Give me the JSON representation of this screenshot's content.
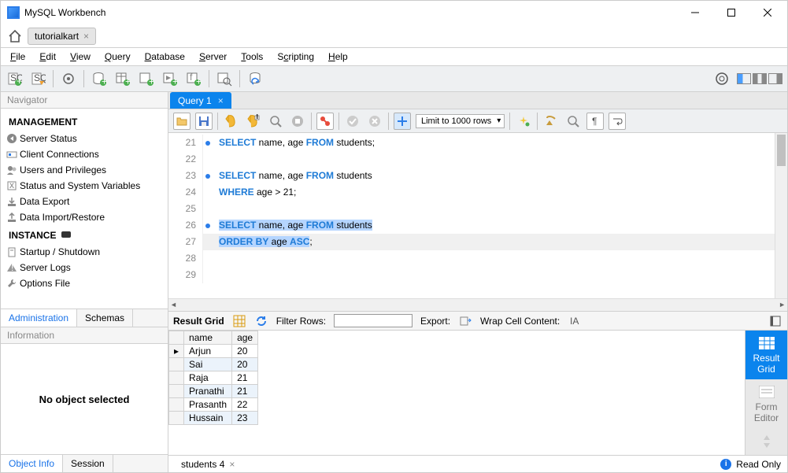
{
  "title": "MySQL Workbench",
  "connection_tab": "tutorialkart",
  "menus": [
    "File",
    "Edit",
    "View",
    "Query",
    "Database",
    "Server",
    "Tools",
    "Scripting",
    "Help"
  ],
  "sidebar": {
    "panel_label": "Navigator",
    "mgmt_header": "MANAGEMENT",
    "mgmt_items": [
      "Server Status",
      "Client Connections",
      "Users and Privileges",
      "Status and System Variables",
      "Data Export",
      "Data Import/Restore"
    ],
    "inst_header": "INSTANCE",
    "inst_items": [
      "Startup / Shutdown",
      "Server Logs",
      "Options File"
    ],
    "tabs": [
      "Administration",
      "Schemas"
    ],
    "info_label": "Information",
    "no_object": "No object selected",
    "info_tabs": [
      "Object Info",
      "Session"
    ]
  },
  "query_tab": "Query 1",
  "limit_label": "Limit to 1000 rows",
  "code": {
    "l21": {
      "n": "21",
      "dot": true,
      "pre": "      ",
      "a": "SELECT",
      "b": " name, age ",
      "c": "FROM",
      "d": " students;"
    },
    "l22": {
      "n": "22"
    },
    "l23": {
      "n": "23",
      "dot": true,
      "pre": "      ",
      "a": "SELECT",
      "b": " name, age ",
      "c": "FROM",
      "d": " students"
    },
    "l24": {
      "n": "24",
      "pre": "      ",
      "a": "WHERE",
      "b": " age > 21;"
    },
    "l25": {
      "n": "25"
    },
    "l26": {
      "n": "26",
      "dot": true,
      "pre": "      ",
      "a": "SELECT",
      "b": " name, age ",
      "c": "FROM",
      "d": " students",
      "sel": true
    },
    "l27": {
      "n": "27",
      "pre": "      ",
      "a": "ORDER BY",
      "b": " age ",
      "c": "ASC",
      "d": ";",
      "sel": true
    },
    "l28": {
      "n": "28"
    },
    "l29": {
      "n": "29"
    }
  },
  "results": {
    "label": "Result Grid",
    "filter_label": "Filter Rows:",
    "export_label": "Export:",
    "wrap_label": "Wrap Cell Content:",
    "cols": [
      "name",
      "age"
    ],
    "rows": [
      {
        "name": "Arjun",
        "age": "20"
      },
      {
        "name": "Sai",
        "age": "20"
      },
      {
        "name": "Raja",
        "age": "21"
      },
      {
        "name": "Pranathi",
        "age": "21"
      },
      {
        "name": "Prasanth",
        "age": "22"
      },
      {
        "name": "Hussain",
        "age": "23"
      }
    ],
    "side": {
      "grid": "Result\nGrid",
      "form": "Form\nEditor"
    },
    "footer_tab": "students 4",
    "readonly": "Read Only"
  }
}
